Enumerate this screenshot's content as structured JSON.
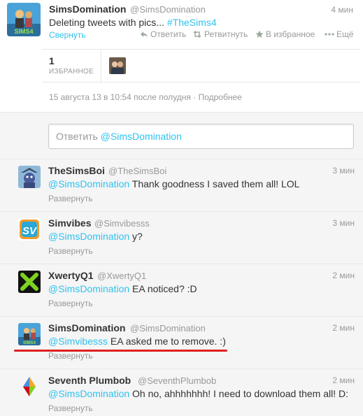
{
  "main_tweet": {
    "name": "SimsDomination",
    "handle": "@SimsDomination",
    "time": "4 мин",
    "text_prefix": "Deleting tweets with pics... ",
    "hashtag": "#TheSims4",
    "collapse": "Свернуть",
    "actions": {
      "reply": "Ответить",
      "retweet": "Ретвитнуть",
      "favorite": "В избранное",
      "more": "Ещё"
    },
    "favorites_count": "1",
    "favorites_label": "ИЗБРАННОЕ",
    "meta": "15 августа 13 в 10:54 после полудня · Подробнее"
  },
  "reply_box": {
    "prefix": "Ответить ",
    "mention": "@SimsDomination"
  },
  "replies": [
    {
      "name": "TheSimsBoi",
      "handle": "@TheSimsBoi",
      "time": "3 мин",
      "mention": "@SimsDomination",
      "text": " Thank goodness I saved them all! LOL",
      "expand": "Развернуть"
    },
    {
      "name": "Simvibes",
      "handle": "@Simvibesss",
      "time": "3 мин",
      "mention": "@SimsDomination",
      "text": " y?",
      "expand": "Развернуть"
    },
    {
      "name": "XwertyQ1",
      "handle": "@XwertyQ1",
      "time": "2 мин",
      "mention": "@SimsDomination",
      "text": " EA noticed? :D",
      "expand": "Развернуть"
    },
    {
      "name": "SimsDomination",
      "handle": "@SimsDomination",
      "time": "2 мин",
      "mention": "@Simvibesss",
      "text": " EA asked me to remove. :)",
      "expand": "Развернуть"
    },
    {
      "name": "Seventh Plumbob",
      "handle": "@SeventhPlumbob",
      "time": "2 мин",
      "mention": "@SimsDomination",
      "text": " Oh no, ahhhhhhh! I need to download them all! D:",
      "expand": "Развернуть"
    }
  ],
  "colors": {
    "link": "#2fc2ef",
    "highlight_underline": "#e02020",
    "background_gray": "#f5f5f5"
  }
}
